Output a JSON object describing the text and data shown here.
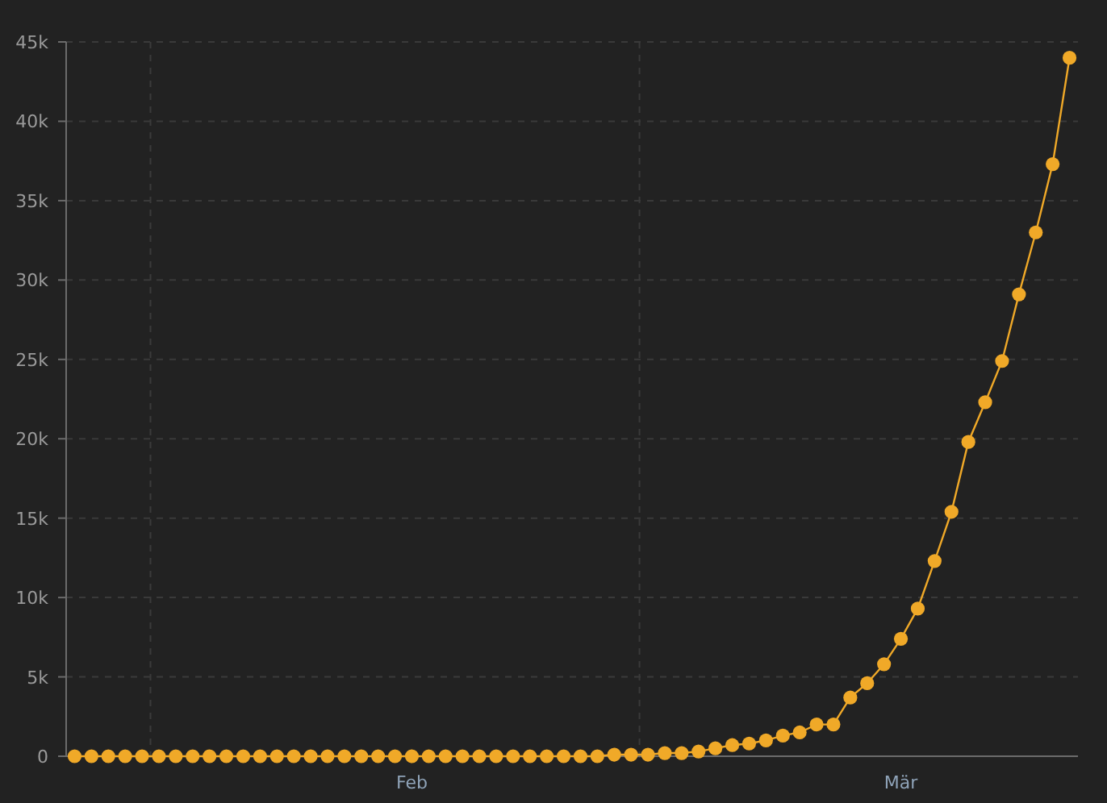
{
  "chart_data": {
    "type": "line",
    "categories": [
      null,
      null,
      null,
      null,
      null,
      null,
      null,
      null,
      null,
      null,
      null,
      null,
      null,
      null,
      null,
      null,
      null,
      null,
      null,
      null,
      "Feb",
      null,
      null,
      null,
      null,
      null,
      null,
      null,
      null,
      null,
      null,
      null,
      null,
      null,
      null,
      null,
      null,
      null,
      null,
      null,
      null,
      null,
      null,
      null,
      null,
      null,
      null,
      null,
      null,
      "Mär",
      null,
      null,
      null,
      null,
      null,
      null,
      null,
      null,
      null,
      null
    ],
    "grid": true,
    "series": [
      {
        "color": "#f0a928",
        "marker": "circle",
        "values": [
          0,
          0,
          0,
          0,
          0,
          0,
          0,
          0,
          0,
          0,
          0,
          0,
          0,
          0,
          0,
          0,
          0,
          0,
          0,
          0,
          0,
          0,
          0,
          0,
          0,
          0,
          0,
          0,
          0,
          0,
          0,
          0,
          100,
          100,
          100,
          200,
          200,
          300,
          500,
          700,
          800,
          1000,
          1300,
          1500,
          2000,
          2000,
          3700,
          4600,
          5800,
          7400,
          9300,
          12300,
          15400,
          19800,
          22300,
          24900,
          29100,
          33000,
          37300,
          44000
        ]
      }
    ],
    "ylim": [
      0,
      45000
    ],
    "yticks": [
      {
        "value": 0,
        "label": "0"
      },
      {
        "value": 5000,
        "label": "5k"
      },
      {
        "value": 10000,
        "label": "10k"
      },
      {
        "value": 15000,
        "label": "15k"
      },
      {
        "value": 20000,
        "label": "20k"
      },
      {
        "value": 25000,
        "label": "25k"
      },
      {
        "value": 30000,
        "label": "30k"
      },
      {
        "value": 35000,
        "label": "35k"
      },
      {
        "value": 40000,
        "label": "40k"
      },
      {
        "value": 45000,
        "label": "45k"
      }
    ]
  }
}
